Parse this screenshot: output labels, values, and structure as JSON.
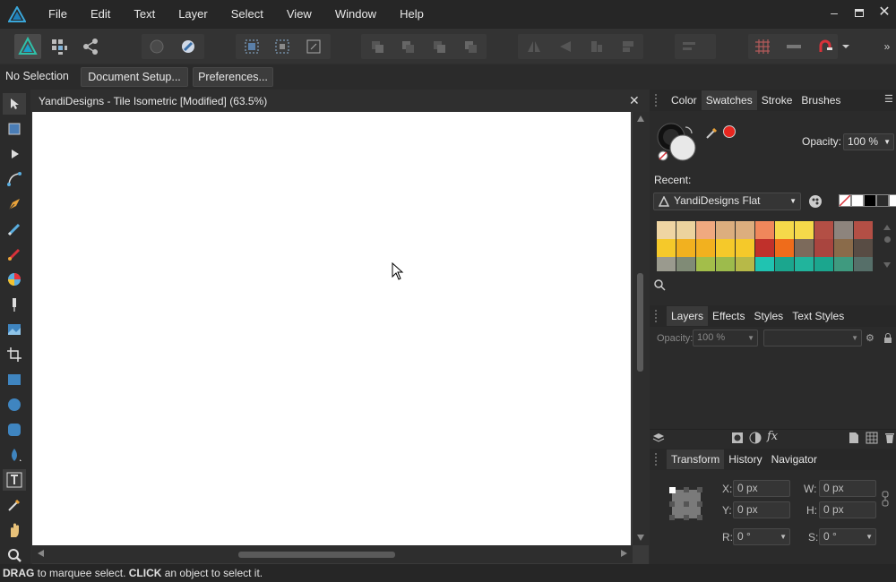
{
  "menu": [
    "File",
    "Edit",
    "Text",
    "Layer",
    "Select",
    "View",
    "Window",
    "Help"
  ],
  "context_bar": {
    "selection": "No Selection",
    "doc_setup": "Document Setup...",
    "preferences": "Preferences..."
  },
  "document": {
    "title": "YandiDesigns - Tile Isometric [Modified] (63.5%)"
  },
  "color_panel": {
    "tabs": [
      "Color",
      "Swatches",
      "Stroke",
      "Brushes"
    ],
    "active_tab": "Swatches",
    "opacity_label": "Opacity:",
    "opacity_value": "100 %",
    "recent_label": "Recent:",
    "palette_name": "YandiDesigns Flat",
    "swatches": [
      [
        "#efd5a3",
        "#ecd39e",
        "#f0a97f",
        "#dcae7e",
        "#dcae7e",
        "#f0875b",
        "#f5d94a",
        "#f5d94a",
        "#b34f45",
        "#8d847d",
        "#b34f45"
      ],
      [
        "#f5c92a",
        "#f2b11f",
        "#f2b11f",
        "#f5c92a",
        "#f5c92a",
        "#c0302b",
        "#ef6c1b",
        "#7c6a5b",
        "#a9453f",
        "#8a6b4a",
        "#584c44"
      ],
      [
        "#9a9a8e",
        "#808b76",
        "#a3be4a",
        "#9dbb4c",
        "#b7b948",
        "#20c3b1",
        "#1ba68e",
        "#21b49c",
        "#1ba68e",
        "#3f9a7f",
        "#566f69"
      ]
    ],
    "recent_colors": [
      "#ffffff",
      "#000000",
      "#2c2c2c",
      "#ffffff"
    ],
    "accent": "#e8261f"
  },
  "layers_panel": {
    "tabs": [
      "Layers",
      "Effects",
      "Styles",
      "Text Styles"
    ],
    "active_tab": "Layers",
    "opacity_label": "Opacity:",
    "opacity_value": "100 %"
  },
  "transform_panel": {
    "tabs": [
      "Transform",
      "History",
      "Navigator"
    ],
    "active_tab": "Transform",
    "x_label": "X:",
    "x_value": "0 px",
    "y_label": "Y:",
    "y_value": "0 px",
    "w_label": "W:",
    "w_value": "0 px",
    "h_label": "H:",
    "h_value": "0 px",
    "r_label": "R:",
    "r_value": "0 °",
    "s_label": "S:",
    "s_value": "0 °"
  },
  "status": {
    "drag": "DRAG",
    "text1": " to marquee select. ",
    "click": "CLICK",
    "text2": " an object to select it."
  }
}
